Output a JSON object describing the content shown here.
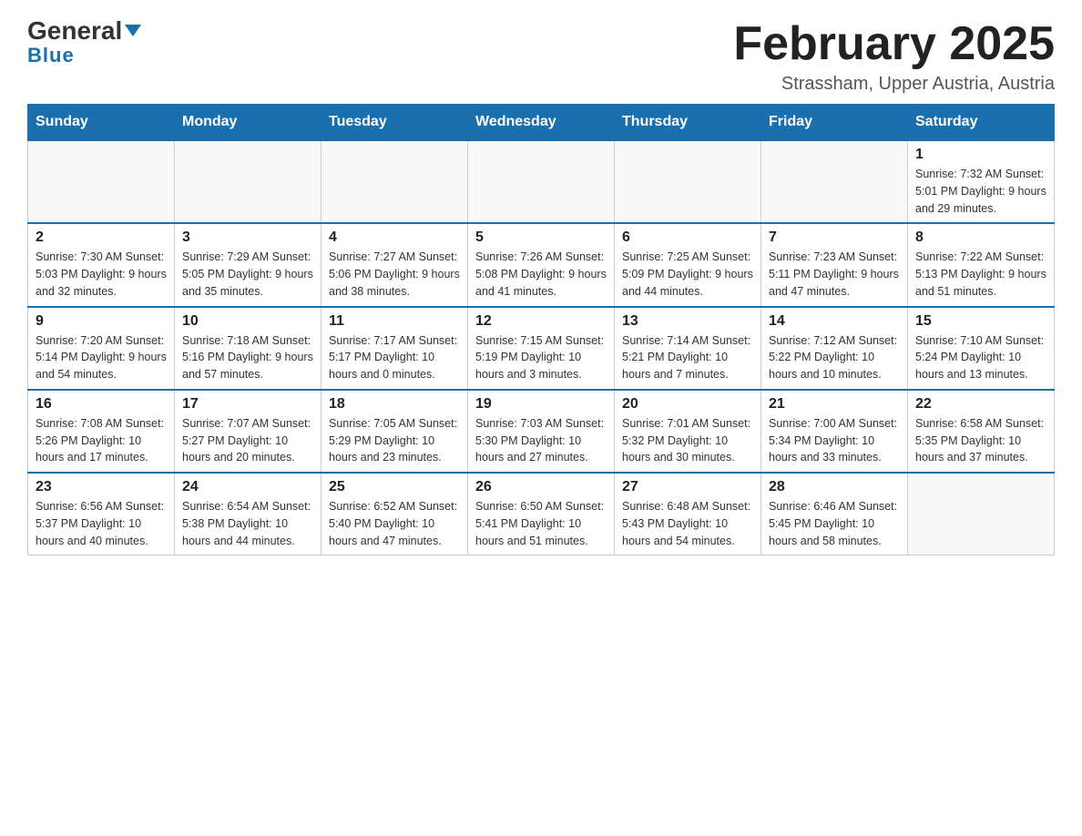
{
  "header": {
    "logo_top": "General",
    "logo_bottom": "Blue",
    "month_title": "February 2025",
    "location": "Strassham, Upper Austria, Austria"
  },
  "weekdays": [
    "Sunday",
    "Monday",
    "Tuesday",
    "Wednesday",
    "Thursday",
    "Friday",
    "Saturday"
  ],
  "weeks": [
    [
      {
        "day": "",
        "info": ""
      },
      {
        "day": "",
        "info": ""
      },
      {
        "day": "",
        "info": ""
      },
      {
        "day": "",
        "info": ""
      },
      {
        "day": "",
        "info": ""
      },
      {
        "day": "",
        "info": ""
      },
      {
        "day": "1",
        "info": "Sunrise: 7:32 AM\nSunset: 5:01 PM\nDaylight: 9 hours and 29 minutes."
      }
    ],
    [
      {
        "day": "2",
        "info": "Sunrise: 7:30 AM\nSunset: 5:03 PM\nDaylight: 9 hours and 32 minutes."
      },
      {
        "day": "3",
        "info": "Sunrise: 7:29 AM\nSunset: 5:05 PM\nDaylight: 9 hours and 35 minutes."
      },
      {
        "day": "4",
        "info": "Sunrise: 7:27 AM\nSunset: 5:06 PM\nDaylight: 9 hours and 38 minutes."
      },
      {
        "day": "5",
        "info": "Sunrise: 7:26 AM\nSunset: 5:08 PM\nDaylight: 9 hours and 41 minutes."
      },
      {
        "day": "6",
        "info": "Sunrise: 7:25 AM\nSunset: 5:09 PM\nDaylight: 9 hours and 44 minutes."
      },
      {
        "day": "7",
        "info": "Sunrise: 7:23 AM\nSunset: 5:11 PM\nDaylight: 9 hours and 47 minutes."
      },
      {
        "day": "8",
        "info": "Sunrise: 7:22 AM\nSunset: 5:13 PM\nDaylight: 9 hours and 51 minutes."
      }
    ],
    [
      {
        "day": "9",
        "info": "Sunrise: 7:20 AM\nSunset: 5:14 PM\nDaylight: 9 hours and 54 minutes."
      },
      {
        "day": "10",
        "info": "Sunrise: 7:18 AM\nSunset: 5:16 PM\nDaylight: 9 hours and 57 minutes."
      },
      {
        "day": "11",
        "info": "Sunrise: 7:17 AM\nSunset: 5:17 PM\nDaylight: 10 hours and 0 minutes."
      },
      {
        "day": "12",
        "info": "Sunrise: 7:15 AM\nSunset: 5:19 PM\nDaylight: 10 hours and 3 minutes."
      },
      {
        "day": "13",
        "info": "Sunrise: 7:14 AM\nSunset: 5:21 PM\nDaylight: 10 hours and 7 minutes."
      },
      {
        "day": "14",
        "info": "Sunrise: 7:12 AM\nSunset: 5:22 PM\nDaylight: 10 hours and 10 minutes."
      },
      {
        "day": "15",
        "info": "Sunrise: 7:10 AM\nSunset: 5:24 PM\nDaylight: 10 hours and 13 minutes."
      }
    ],
    [
      {
        "day": "16",
        "info": "Sunrise: 7:08 AM\nSunset: 5:26 PM\nDaylight: 10 hours and 17 minutes."
      },
      {
        "day": "17",
        "info": "Sunrise: 7:07 AM\nSunset: 5:27 PM\nDaylight: 10 hours and 20 minutes."
      },
      {
        "day": "18",
        "info": "Sunrise: 7:05 AM\nSunset: 5:29 PM\nDaylight: 10 hours and 23 minutes."
      },
      {
        "day": "19",
        "info": "Sunrise: 7:03 AM\nSunset: 5:30 PM\nDaylight: 10 hours and 27 minutes."
      },
      {
        "day": "20",
        "info": "Sunrise: 7:01 AM\nSunset: 5:32 PM\nDaylight: 10 hours and 30 minutes."
      },
      {
        "day": "21",
        "info": "Sunrise: 7:00 AM\nSunset: 5:34 PM\nDaylight: 10 hours and 33 minutes."
      },
      {
        "day": "22",
        "info": "Sunrise: 6:58 AM\nSunset: 5:35 PM\nDaylight: 10 hours and 37 minutes."
      }
    ],
    [
      {
        "day": "23",
        "info": "Sunrise: 6:56 AM\nSunset: 5:37 PM\nDaylight: 10 hours and 40 minutes."
      },
      {
        "day": "24",
        "info": "Sunrise: 6:54 AM\nSunset: 5:38 PM\nDaylight: 10 hours and 44 minutes."
      },
      {
        "day": "25",
        "info": "Sunrise: 6:52 AM\nSunset: 5:40 PM\nDaylight: 10 hours and 47 minutes."
      },
      {
        "day": "26",
        "info": "Sunrise: 6:50 AM\nSunset: 5:41 PM\nDaylight: 10 hours and 51 minutes."
      },
      {
        "day": "27",
        "info": "Sunrise: 6:48 AM\nSunset: 5:43 PM\nDaylight: 10 hours and 54 minutes."
      },
      {
        "day": "28",
        "info": "Sunrise: 6:46 AM\nSunset: 5:45 PM\nDaylight: 10 hours and 58 minutes."
      },
      {
        "day": "",
        "info": ""
      }
    ]
  ]
}
